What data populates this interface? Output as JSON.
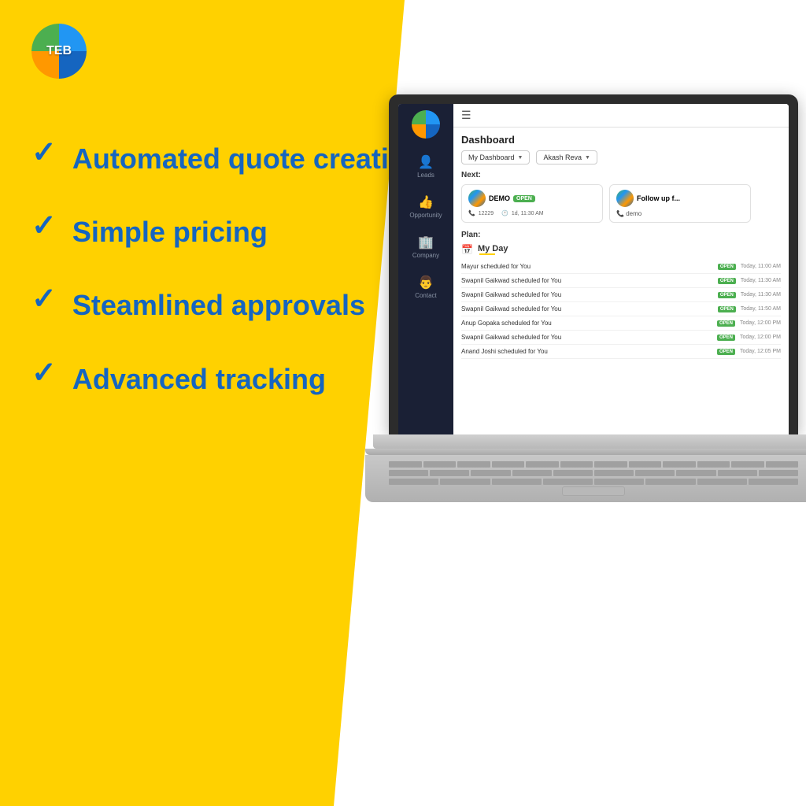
{
  "brand": {
    "logo_text": "TEB",
    "logo_colors": [
      "#4CAF50",
      "#2196F3",
      "#FF9800",
      "#1565C0"
    ]
  },
  "features": [
    {
      "id": "feature-1",
      "checkmark": "✓",
      "text": "Automated quote creation"
    },
    {
      "id": "feature-2",
      "checkmark": "✓",
      "text": "Simple pricing"
    },
    {
      "id": "feature-3",
      "checkmark": "✓",
      "text": "Steamlined approvals"
    },
    {
      "id": "feature-4",
      "checkmark": "✓",
      "text": "Advanced tracking"
    }
  ],
  "dashboard": {
    "title": "Dashboard",
    "filter1_label": "My Dashboard",
    "filter2_label": "Akash Reva",
    "next_section": "Next:",
    "card1_name": "DEMO",
    "card1_status": "OPEN",
    "card1_phone": "12229",
    "card1_time": "1d, 11:30 AM",
    "card2_name": "Follow up f...",
    "card2_label": "demo",
    "plan_section": "Plan:",
    "my_day_title": "My Day",
    "schedule_items": [
      {
        "name": "Mayur scheduled for You",
        "status": "OPEN",
        "time": "Today, 11:00 AM"
      },
      {
        "name": "Swapnil Gaikwad scheduled for You",
        "status": "OPEN",
        "time": "Today, 11:30 AM"
      },
      {
        "name": "Swapnil Gaikwad scheduled for You",
        "status": "OPEN",
        "time": "Today, 11:30 AM"
      },
      {
        "name": "Swapnil Gaikwad scheduled for You",
        "status": "OPEN",
        "time": "Today, 11:50 AM"
      },
      {
        "name": "Anup Gopaka scheduled for You",
        "status": "OPEN",
        "time": "Today, 12:00 PM"
      },
      {
        "name": "Swapnil Gaikwad scheduled for You",
        "status": "OPEN",
        "time": "Today, 12:00 PM"
      },
      {
        "name": "Anand Joshi scheduled for You",
        "status": "OPEN",
        "time": "Today, 12:05 PM"
      }
    ]
  },
  "sidebar": {
    "items": [
      {
        "label": "Leads",
        "icon": "👤"
      },
      {
        "label": "Opportunity",
        "icon": "👍"
      },
      {
        "label": "Company",
        "icon": "🏢"
      },
      {
        "label": "Contact",
        "icon": "👨"
      }
    ]
  }
}
